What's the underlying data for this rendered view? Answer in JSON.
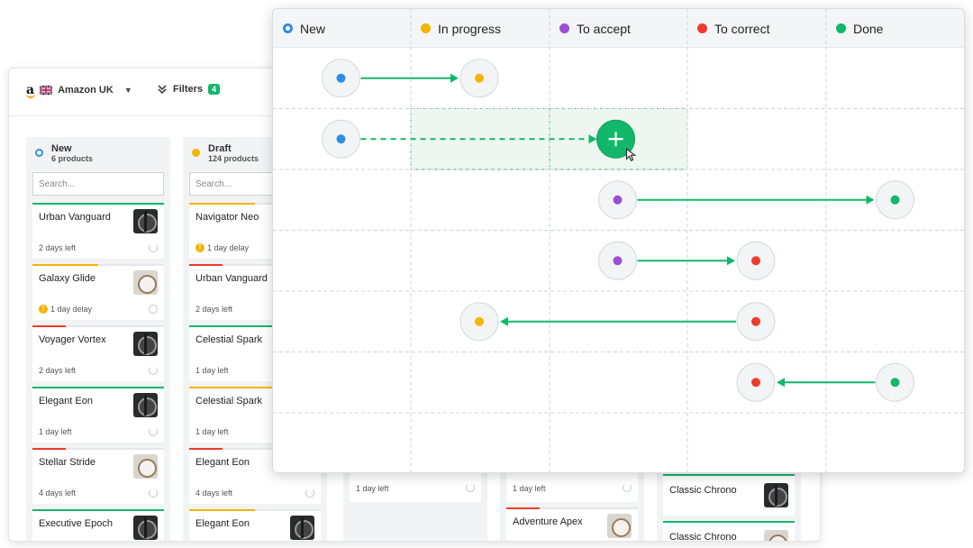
{
  "colors": {
    "green": "#12b76a",
    "blue": "#2e8ee6",
    "yellow": "#f5b400",
    "purple": "#9b4fd6",
    "red": "#ef3b2d",
    "grey": "#c4c7cc"
  },
  "app": {
    "store_label": "Amazon UK",
    "filters_label": "Filters",
    "filters_count": "4",
    "search_placeholder": "Search...",
    "columns": [
      {
        "name": "New",
        "count": "6 products",
        "cards": [
          {
            "title": "Urban Vanguard",
            "time": "2 days left",
            "accent": "#12b76a",
            "watch": "dark"
          },
          {
            "title": "Galaxy Glide",
            "time": "1 day delay",
            "accent": "#f5b400",
            "watch": "light"
          },
          {
            "title": "Voyager Vortex",
            "time": "2 days left",
            "accent": "#ef3b2d",
            "watch": "dark"
          },
          {
            "title": "Elegant Eon",
            "time": "1 day left",
            "accent": "#12b76a",
            "watch": "dark"
          },
          {
            "title": "Stellar Stride",
            "time": "4 days left",
            "accent": "#ef3b2d",
            "watch": "light"
          },
          {
            "title": "Executive Epoch",
            "time": "",
            "accent": "#12b76a",
            "watch": "dark"
          }
        ]
      },
      {
        "name": "Draft",
        "count": "124 products",
        "cards": [
          {
            "title": "Navigator Neo",
            "time": "1 day delay",
            "accent": "#f5b400"
          },
          {
            "title": "Urban Vanguard",
            "time": "2 days left",
            "accent": "#ef3b2d"
          },
          {
            "title": "Celestial Spark",
            "time": "1 day left",
            "accent": "#12b76a"
          },
          {
            "title": "Celestial Spark",
            "time": "1 day left",
            "accent": "#f5b400"
          },
          {
            "title": "Elegant Eon",
            "time": "4 days left",
            "accent": "#ef3b2d"
          },
          {
            "title": "Elegant Eon",
            "time": "",
            "accent": "#f5b400",
            "watch": "dark"
          }
        ]
      }
    ],
    "peek_cards": [
      {
        "title": "",
        "time": "1 day left"
      },
      {
        "title": "Adventure Apex",
        "time": "1 day left"
      },
      {
        "title": "Classic Chrono",
        "time": ""
      },
      {
        "title": "Classic Chrono",
        "time": ""
      }
    ]
  },
  "flow": {
    "statuses": [
      {
        "label": "New",
        "color": "#2e8ee6"
      },
      {
        "label": "In progress",
        "color": "#f5b400"
      },
      {
        "label": "To accept",
        "color": "#9b4fd6"
      },
      {
        "label": "To correct",
        "color": "#ef3b2d"
      },
      {
        "label": "Done",
        "color": "#12b76a"
      }
    ],
    "transitions": [
      {
        "from": 0,
        "to": 1
      },
      {
        "from": 0,
        "to": 2,
        "pending": true
      },
      {
        "from": 2,
        "to": 4
      },
      {
        "from": 2,
        "to": 3
      },
      {
        "from": 3,
        "to": 1
      },
      {
        "from": 4,
        "to": 3
      }
    ]
  }
}
